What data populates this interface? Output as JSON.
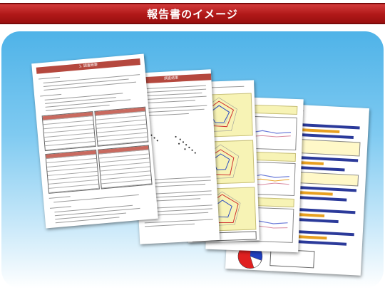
{
  "header": {
    "title": "報告書のイメージ"
  },
  "document": {
    "section_title": "1. 調査概要",
    "page2_title": "調査結果"
  },
  "colors": {
    "banner": "#b01818",
    "stage_top": "#4fb3e8",
    "sheet_header": "#b5483e",
    "bar_blue": "#2b3a9a",
    "bar_orange": "#e8a020",
    "pie_red": "#e02020",
    "pie_blue": "#2040c0"
  }
}
